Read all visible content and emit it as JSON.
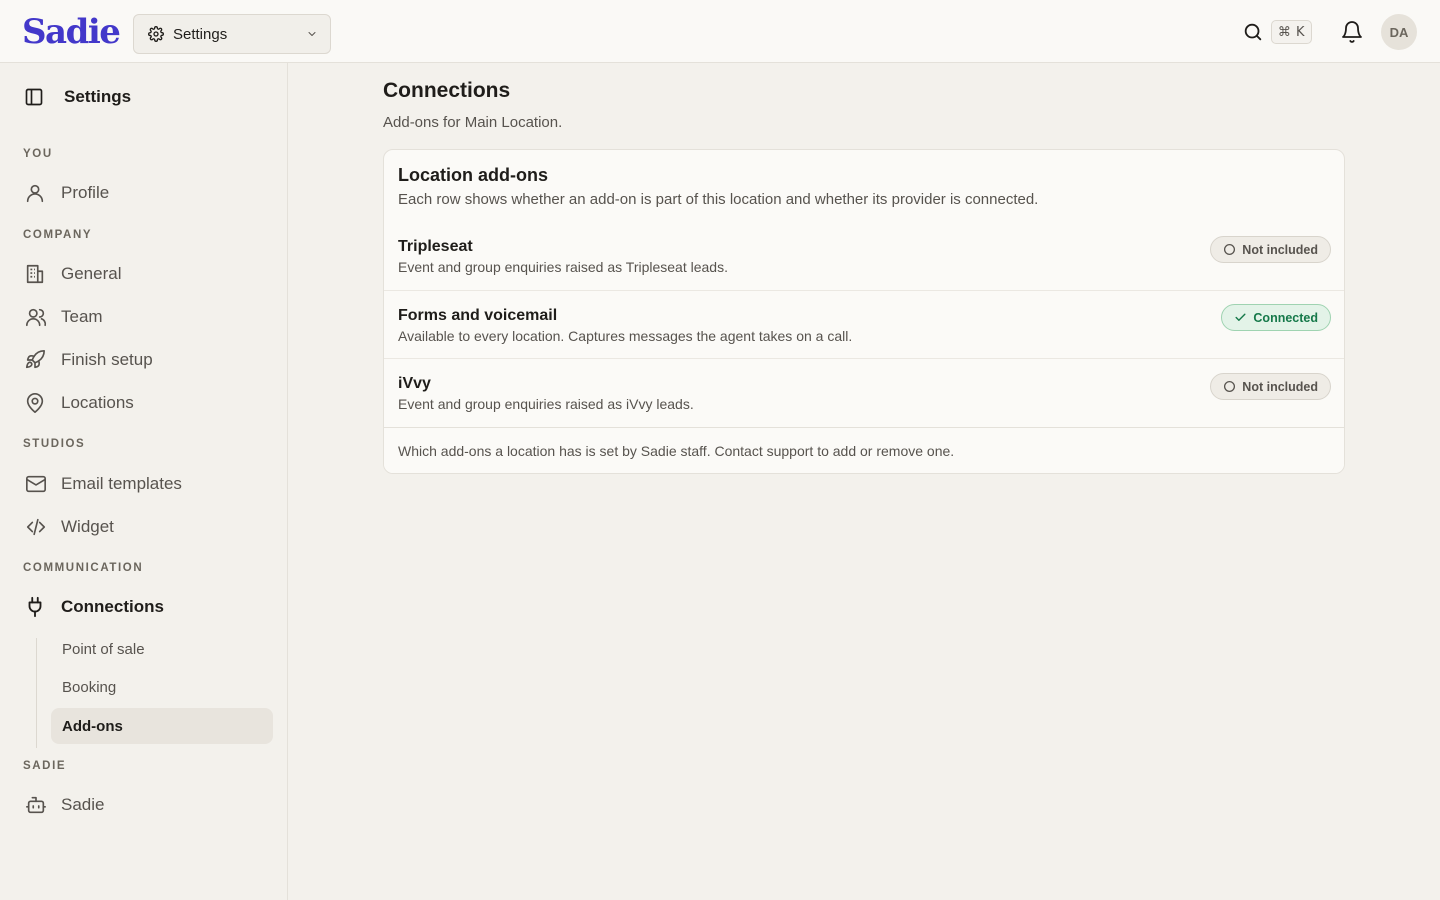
{
  "app": {
    "logo": "Sadie"
  },
  "topbar": {
    "switcher_label": "Settings",
    "search_shortcut": "⌘ K",
    "avatar_initials": "DA"
  },
  "sidebar": {
    "header": "Settings",
    "sections": {
      "you": "YOU",
      "company": "COMPANY",
      "studios": "STUDIOS",
      "communication": "COMMUNICATION",
      "sadie": "SADIE"
    },
    "items": {
      "profile": "Profile",
      "general": "General",
      "team": "Team",
      "finish_setup": "Finish setup",
      "locations": "Locations",
      "email_templates": "Email templates",
      "widget": "Widget",
      "connections": "Connections",
      "sadie": "Sadie"
    },
    "connections_sub": {
      "point_of_sale": "Point of sale",
      "booking": "Booking",
      "add_ons": "Add-ons"
    }
  },
  "main": {
    "title": "Connections",
    "subtitle": "Add-ons for Main Location.",
    "card": {
      "title": "Location add-ons",
      "description": "Each row shows whether an add-on is part of this location and whether its provider is connected.",
      "rows": [
        {
          "name": "Tripleseat",
          "description": "Event and group enquiries raised as Tripleseat leads.",
          "status": "Not included"
        },
        {
          "name": "Forms and voicemail",
          "description": "Available to every location. Captures messages the agent takes on a call.",
          "status": "Connected"
        },
        {
          "name": "iVvy",
          "description": "Event and group enquiries raised as iVvy leads.",
          "status": "Not included"
        }
      ],
      "footer": "Which add-ons a location has is set by Sadie staff. Contact support to add or remove one."
    }
  },
  "colors": {
    "brand": "#4338ca",
    "connected": "#16794a",
    "background": "#f3f1ec"
  }
}
